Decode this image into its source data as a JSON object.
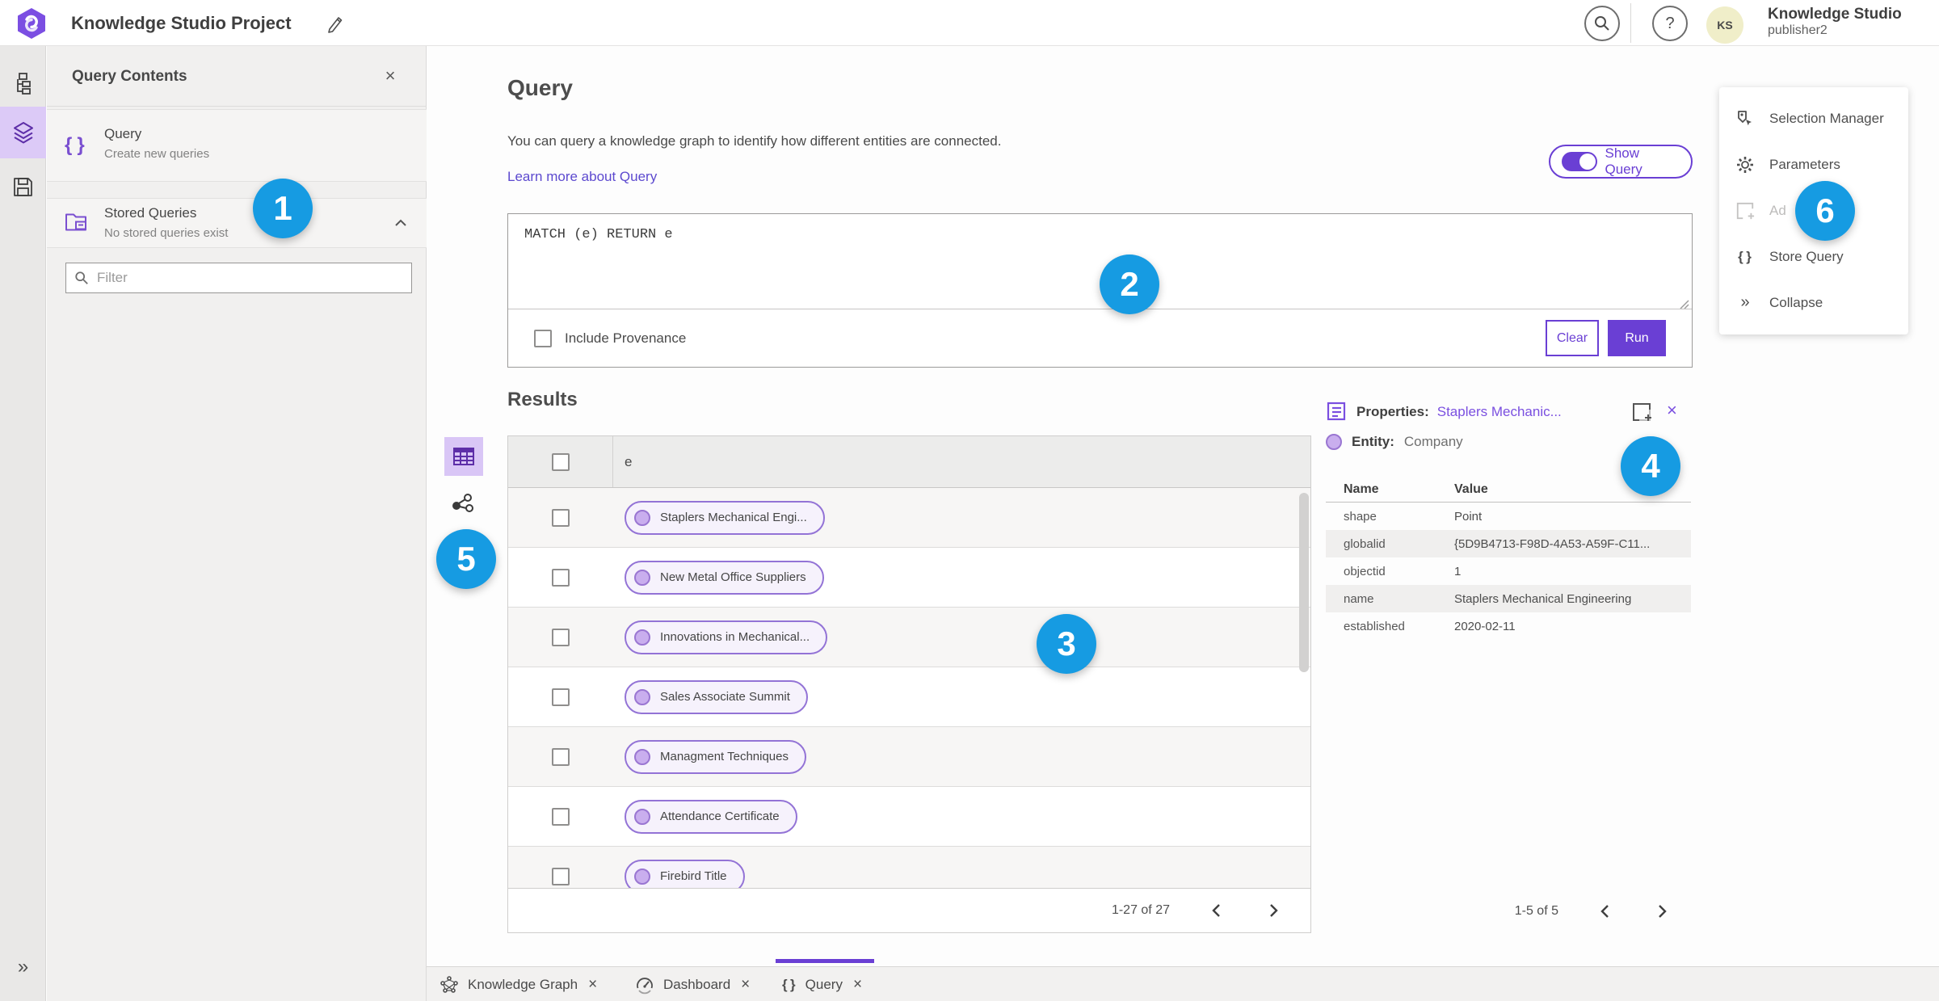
{
  "header": {
    "title": "Knowledge Studio Project",
    "user": {
      "initials": "KS",
      "name": "Knowledge Studio",
      "role": "publisher2"
    }
  },
  "query_contents": {
    "title": "Query Contents",
    "items": [
      {
        "label": "Query",
        "description": "Create new queries"
      },
      {
        "label": "Stored Queries",
        "description": "No stored queries exist"
      }
    ],
    "filter_placeholder": "Filter"
  },
  "query_section": {
    "title": "Query",
    "description": "You can query a knowledge graph to identify how different entities are connected.",
    "learn_more": "Learn more about Query",
    "show_query_label": "Show Query",
    "query_text": "MATCH (e) RETURN e",
    "include_provenance_label": "Include Provenance",
    "clear_label": "Clear",
    "run_label": "Run"
  },
  "results": {
    "title": "Results",
    "column_header": "e",
    "rows": [
      "Staplers Mechanical Engi...",
      "New Metal Office Suppliers",
      "Innovations in Mechanical...",
      "Sales Associate Summit",
      "Managment Techniques",
      "Attendance Certificate",
      "Firebird Title"
    ],
    "pagination": "1-27 of 27"
  },
  "properties": {
    "title": "Properties:",
    "entity_link": "Staplers Mechanic...",
    "entity_label": "Entity:",
    "entity_type": "Company",
    "columns": [
      "Name",
      "Value"
    ],
    "rows": [
      {
        "name": "shape",
        "value": "Point"
      },
      {
        "name": "globalid",
        "value": "{5D9B4713-F98D-4A53-A59F-C11..."
      },
      {
        "name": "objectid",
        "value": "1"
      },
      {
        "name": "name",
        "value": "Staplers Mechanical Engineering"
      },
      {
        "name": "established",
        "value": "2020-02-11"
      }
    ],
    "pagination": "1-5 of 5"
  },
  "action_menu": {
    "items": [
      {
        "label": "Selection Manager"
      },
      {
        "label": "Parameters"
      },
      {
        "label": "Ad"
      },
      {
        "label": "Store Query"
      },
      {
        "label": "Collapse"
      }
    ]
  },
  "tabs": [
    {
      "label": "Knowledge Graph"
    },
    {
      "label": "Dashboard"
    },
    {
      "label": "Query"
    }
  ],
  "badges": [
    "1",
    "2",
    "3",
    "4",
    "5",
    "6"
  ],
  "colors": {
    "accent_purple": "#6a3fd4",
    "link_purple": "#5c49cf",
    "badge_blue": "#169be2",
    "chip_fill": "#c9aeee",
    "active_rail_bg": "#dccaf7"
  }
}
